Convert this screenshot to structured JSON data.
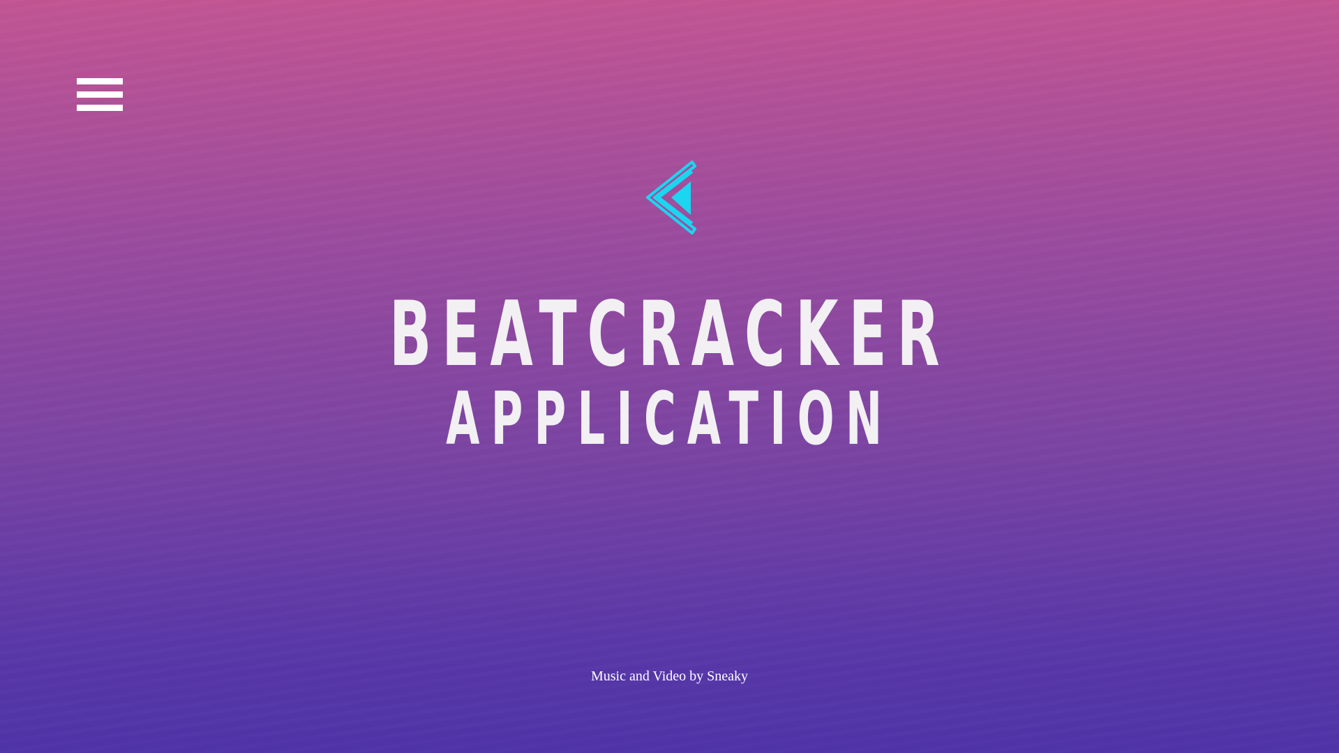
{
  "menu": {
    "icon": "hamburger-menu-icon"
  },
  "logo": {
    "icon": "double-chevron-play-left-icon",
    "color": "#1ad6f0"
  },
  "title": {
    "main": "BEATCRACKER",
    "sub": "APPLICATION"
  },
  "credit": {
    "text": "Music and Video by Sneaky"
  },
  "colors": {
    "gradient_top": "#c25593",
    "gradient_bottom": "#4f34a8",
    "text": "#f2f0f3"
  }
}
